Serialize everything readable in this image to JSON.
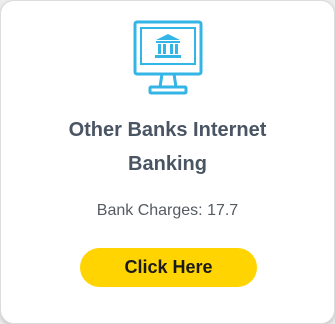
{
  "card": {
    "icon": "bank-monitor-icon",
    "title_line1": "Other Banks Internet",
    "title_line2": "Banking",
    "charges_label": "Bank Charges: 17.7",
    "button_label": "Click Here"
  },
  "colors": {
    "icon_stroke": "#33b5e5",
    "button_bg": "#ffd400",
    "title_text": "#4a5563"
  }
}
